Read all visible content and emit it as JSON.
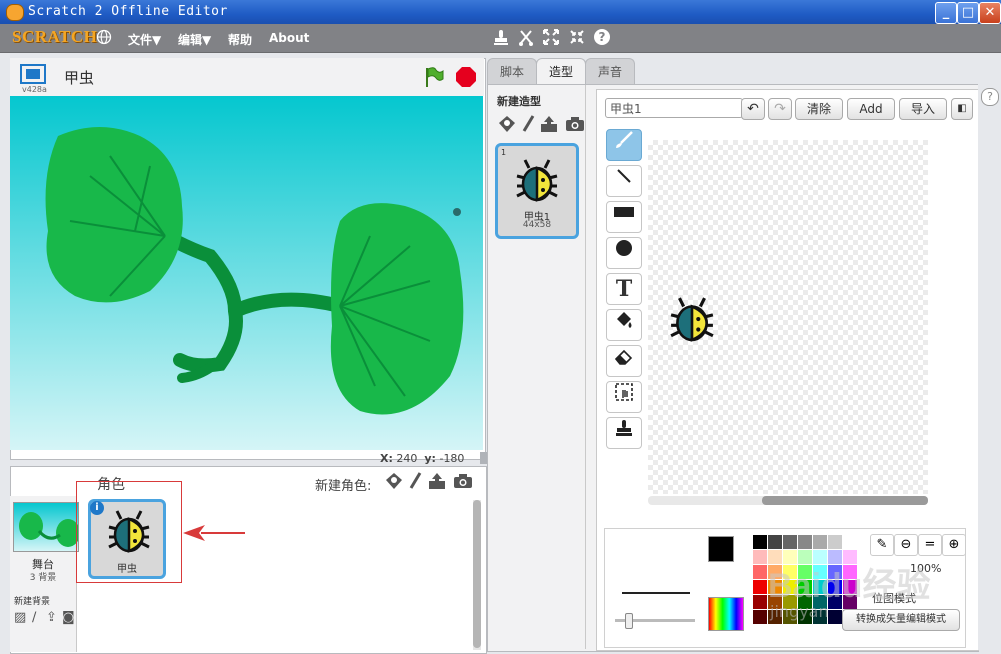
{
  "window": {
    "title": "Scratch 2 Offline Editor",
    "minimize": "_",
    "maximize": "□",
    "close": "✕"
  },
  "menubar": {
    "logo": "SCRATCH",
    "items": [
      {
        "label": "文件▼"
      },
      {
        "label": "编辑▼"
      },
      {
        "label": "帮助"
      },
      {
        "label": "About"
      }
    ],
    "help_symbol": "?"
  },
  "stage": {
    "sprite_name": "甲虫",
    "version": "v428a",
    "coords": {
      "x_label": "X:",
      "x_value": "240",
      "y_label": "y:",
      "y_value": "-180"
    }
  },
  "sprites_panel": {
    "title": "角色",
    "new_sprite_label": "新建角色:",
    "stage_thumb": {
      "label": "舞台",
      "count": "3 背景"
    },
    "new_backdrop_label": "新建背景",
    "sprites": [
      {
        "name": "甲虫",
        "info": "i"
      }
    ]
  },
  "tabs": [
    {
      "label": "脚本",
      "active": false
    },
    {
      "label": "造型",
      "active": true
    },
    {
      "label": "声音",
      "active": false
    }
  ],
  "costumes": {
    "new_costume_label": "新建造型",
    "items": [
      {
        "index": "1",
        "name": "甲虫1",
        "size": "44x58"
      }
    ]
  },
  "paint_editor": {
    "costume_name": "甲虫1",
    "clear_label": "清除",
    "add_label": "Add",
    "import_label": "导入",
    "zoom_label": "100%",
    "bitmap_mode_label": "位图模式",
    "convert_vector_label": "转换成矢量编辑模式",
    "tools": [
      "brush",
      "line",
      "rectangle",
      "ellipse",
      "text",
      "fill",
      "eraser",
      "select",
      "stamp"
    ]
  },
  "colors": {
    "menubar": "#818286",
    "stage_top": "#05c7cf",
    "leaf": "#18b84a",
    "selected": "#4aa3df",
    "annotation": "#d83a3a"
  },
  "watermark": {
    "text": "Baidu经验",
    "sub": "jingyan"
  }
}
